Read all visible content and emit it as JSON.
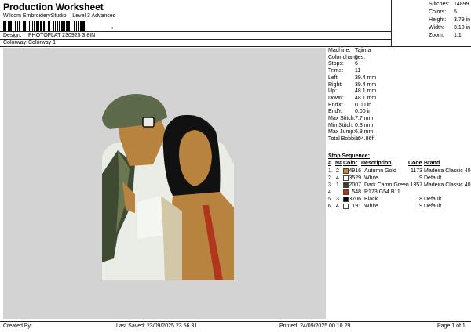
{
  "header": {
    "title": "Production Worksheet",
    "subtitle": "Wilcom EmbroideryStudio – Level 3 Advanced",
    "barcode_text": ",",
    "design_label": "Design:",
    "design_value": "PHOTOFLAT 230925 3,8IN",
    "colorway_label": "Colorway:",
    "colorway_value": "Colorway 1"
  },
  "stats": {
    "stitches_label": "Stitches:",
    "stitches_value": "14899",
    "colors_label": "Colors:",
    "colors_value": "5",
    "height_label": "Height:",
    "height_value": "3.79 in",
    "width_label": "Width:",
    "width_value": "3.10 in",
    "zoom_label": "Zoom:",
    "zoom_value": "1:1"
  },
  "machine_info": [
    {
      "label": "Machine:",
      "value": "Tajima"
    },
    {
      "label": "Color changes:",
      "value": "5"
    },
    {
      "label": "Stops:",
      "value": "6"
    },
    {
      "label": "Trims:",
      "value": "11"
    },
    {
      "label": "Left:",
      "value": "39.4 mm"
    },
    {
      "label": "Right:",
      "value": "39.4 mm"
    },
    {
      "label": "Up:",
      "value": "48.1 mm"
    },
    {
      "label": "Down:",
      "value": "48.1 mm"
    },
    {
      "label": "EndX:",
      "value": "0.00 in"
    },
    {
      "label": "EndY:",
      "value": "0.00 in"
    },
    {
      "label": "Max Stitch:",
      "value": "7.7 mm"
    },
    {
      "label": "Min Stitch:",
      "value": "0.3 mm"
    },
    {
      "label": "Max Jump:",
      "value": "6.8 mm"
    },
    {
      "label": "Total Bobbin:",
      "value": "104.86ft"
    }
  ],
  "stop_sequence": {
    "title": "Stop Sequence:",
    "headers": {
      "hash": "#",
      "n": "N#",
      "color": "Color",
      "description": "Description",
      "code": "Code",
      "brand": "Brand"
    },
    "rows": [
      {
        "idx": "1.",
        "n": "2",
        "color": "#c8882f",
        "num": "4916",
        "desc": "Autumn Gold",
        "code": "1173",
        "brand": "Madeira Classic 40"
      },
      {
        "idx": "2.",
        "n": "4",
        "color": "#ffffff",
        "num": "3529",
        "desc": "White",
        "code": "9",
        "brand": "Default"
      },
      {
        "idx": "3.",
        "n": "1",
        "color": "#3a3d2c",
        "num": "2007",
        "desc": "Dark Camo Green",
        "code": "1357",
        "brand": "Madeira Classic 40"
      },
      {
        "idx": "4.",
        "n": "",
        "color": "#b1361e",
        "num": "548",
        "desc": "R173 G54 B11",
        "code": "",
        "brand": ""
      },
      {
        "idx": "5.",
        "n": "3",
        "color": "#000000",
        "num": "3706",
        "desc": "Black",
        "code": "8",
        "brand": "Default"
      },
      {
        "idx": "6.",
        "n": "4",
        "color": "#ffffff",
        "num": "191",
        "desc": "White",
        "code": "9",
        "brand": "Default"
      }
    ]
  },
  "footer": {
    "created_by": "Created By:",
    "last_saved": "Last Saved: 23/09/2025 23.56.31",
    "printed": "Printed: 24/09/2025 00.10.29",
    "page": "Page 1 of 1"
  },
  "colors": {
    "canvas_bg": "#d3d3d3",
    "skin": "#b8823f",
    "cap": "#5c6a4b",
    "jacket": "#3f4a33",
    "shirt": "#e9ede6",
    "hair": "#111111",
    "strap": "#b1361e"
  }
}
